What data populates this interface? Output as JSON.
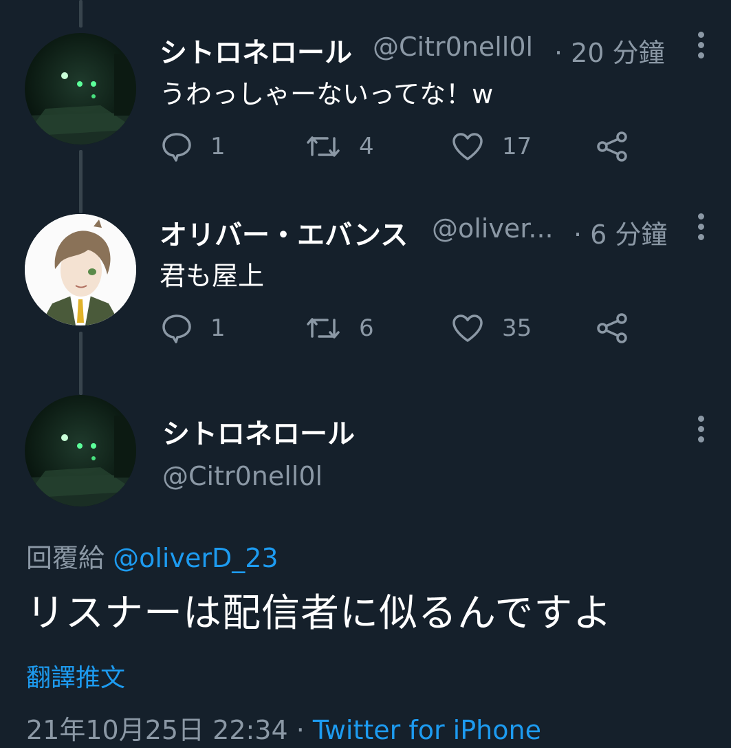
{
  "tweet1": {
    "name": "シトロネロール",
    "handle": "@Citr0nell0l",
    "time": "· 20 分鐘",
    "text": "うわっしゃーないってな！w",
    "replies": "1",
    "retweets": "4",
    "likes": "17"
  },
  "tweet2": {
    "name": "オリバー・エバンス",
    "handle": "@oliver...",
    "time": "· 6 分鐘",
    "text": "君も屋上",
    "replies": "1",
    "retweets": "6",
    "likes": "35"
  },
  "main_tweet": {
    "name": "シトロネロール",
    "handle": "@Citr0nell0l",
    "reply_prefix": "回覆給",
    "reply_to": "@oliverD_23",
    "text": "リスナーは配信者に似るんですよ",
    "translate": "翻譯推文",
    "timestamp": "21年10月25日 22:34 ·",
    "source": "Twitter for iPhone"
  },
  "colors": {
    "background": "#15202b",
    "muted": "#8b98a5",
    "accent": "#1d9bf0",
    "thread_line": "#38444d"
  },
  "icons": [
    "reply-icon",
    "retweet-icon",
    "like-icon",
    "share-icon",
    "more-icon"
  ]
}
